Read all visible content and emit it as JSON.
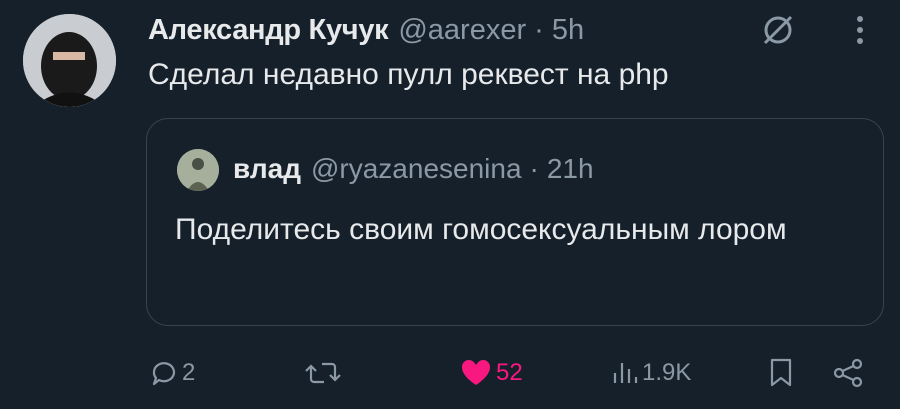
{
  "tweet": {
    "author_name": "Александр Кучук",
    "author_handle": "@aarexer",
    "separator": "·",
    "time": "5h",
    "text": "Сделал недавно пулл реквест на php"
  },
  "quoted": {
    "author_name": "влад",
    "author_handle": "@ryazanesenina",
    "separator": "·",
    "time": "21h",
    "text": "Поделитесь своим гомосексуальным лором"
  },
  "actions": {
    "replies": "2",
    "retweets": "",
    "likes": "52",
    "views": "1.9K"
  },
  "colors": {
    "background": "#15202b",
    "text": "#e7e9ea",
    "secondary": "#8b98a5",
    "like": "#f91880",
    "border": "#38444d"
  },
  "icons": [
    "mute-icon",
    "more-icon",
    "reply-icon",
    "retweet-icon",
    "heart-icon",
    "views-icon",
    "bookmark-icon",
    "share-icon"
  ]
}
